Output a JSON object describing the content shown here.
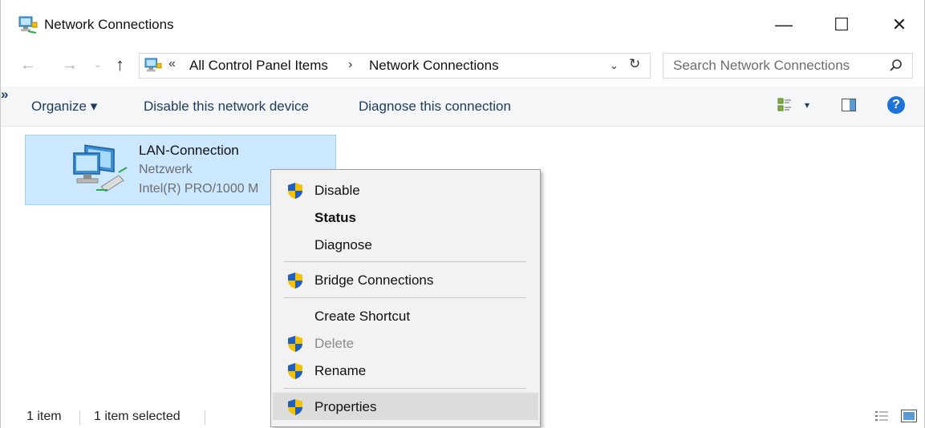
{
  "window": {
    "title": "Network Connections",
    "controls": {
      "minimize": "—",
      "maximize": "☐",
      "close": "✕"
    }
  },
  "navigation": {
    "back": "←",
    "forward": "→",
    "recent": "⌄",
    "up": "↑",
    "breadcrumb_chevron": "«",
    "crumbs": [
      "All Control Panel Items",
      "Network Connections"
    ],
    "separator": "›",
    "dropdown": "⌄",
    "refresh": "↻",
    "search_placeholder": "Search Network Connections"
  },
  "commandbar": {
    "organize": "Organize ▾",
    "disable": "Disable this network device",
    "diagnose": "Diagnose this connection",
    "more": "»",
    "view_dropdown": "▾",
    "help": "?"
  },
  "item": {
    "name": "LAN-Connection",
    "type": "Netzwerk",
    "device": "Intel(R) PRO/1000 M"
  },
  "statusbar": {
    "count": "1 item",
    "selected": "1 item selected"
  },
  "context_menu": {
    "items": [
      {
        "label": "Disable",
        "shield": true,
        "bold": false,
        "disabled": false
      },
      {
        "label": "Status",
        "shield": false,
        "bold": true,
        "disabled": false
      },
      {
        "label": "Diagnose",
        "shield": false,
        "bold": false,
        "disabled": false
      },
      {
        "label": "Bridge Connections",
        "shield": true,
        "bold": false,
        "disabled": false
      },
      {
        "label": "Create Shortcut",
        "shield": false,
        "bold": false,
        "disabled": false
      },
      {
        "label": "Delete",
        "shield": true,
        "bold": false,
        "disabled": true
      },
      {
        "label": "Rename",
        "shield": true,
        "bold": false,
        "disabled": false
      },
      {
        "label": "Properties",
        "shield": true,
        "bold": false,
        "disabled": false,
        "highlighted": true
      }
    ]
  },
  "colors": {
    "selection_bg": "#cce8ff",
    "selection_border": "#99d1ff",
    "command_text": "#1e3a5f",
    "help_blue": "#1e73d8",
    "shield_blue": "#1f5fbf",
    "shield_yellow": "#f2c200"
  }
}
